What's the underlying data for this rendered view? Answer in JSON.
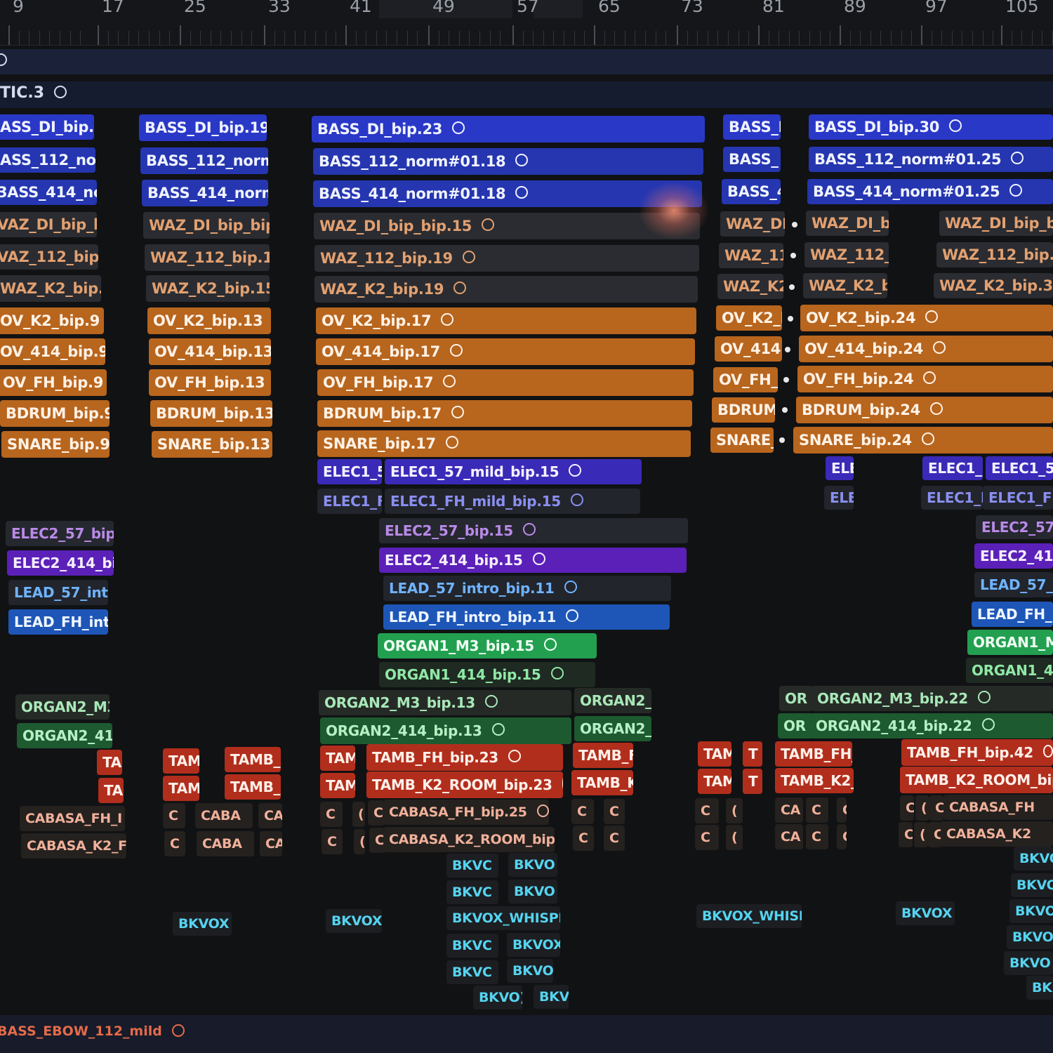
{
  "ruler": {
    "bars": [
      "9",
      "17",
      "25",
      "33",
      "41",
      "49",
      "57",
      "65",
      "73",
      "81",
      "89",
      "97",
      "105"
    ]
  },
  "lanes": {
    "top_label": "",
    "tic_label": "TIC.3",
    "bottom_label": "BASS_EBOW_112_mild"
  },
  "clips": [
    {
      "text": "ASS_DI_bip.1",
      "tone": "blue",
      "circle": false
    },
    {
      "text": "BASS_DI_bip.19",
      "tone": "blue",
      "circle": false
    },
    {
      "text": "BASS_DI_bip.23",
      "tone": "blue",
      "circle": true
    },
    {
      "text": "BASS_I",
      "tone": "blue",
      "circle": false
    },
    {
      "text": "BASS_DI_bip.30",
      "tone": "blue",
      "circle": true
    },
    {
      "text": "ASS_112_nor",
      "tone": "dblue",
      "circle": false
    },
    {
      "text": "BASS_112_norm",
      "tone": "dblue",
      "circle": false
    },
    {
      "text": "BASS_112_norm#01.18",
      "tone": "dblue",
      "circle": true
    },
    {
      "text": "BASS_",
      "tone": "dblue",
      "circle": false
    },
    {
      "text": "BASS_112_norm#01.25",
      "tone": "dblue",
      "circle": true
    },
    {
      "text": "3ASS_414_nor",
      "tone": "dblue",
      "circle": false
    },
    {
      "text": "BASS_414_norm",
      "tone": "dblue",
      "circle": false
    },
    {
      "text": "BASS_414_norm#01.18",
      "tone": "dblue",
      "circle": true
    },
    {
      "text": "BASS_4",
      "tone": "dblue",
      "circle": false
    },
    {
      "text": "BASS_414_norm#01.25",
      "tone": "dblue",
      "circle": true
    },
    {
      "text": "VAZ_DI_bip_b",
      "tone": "gray",
      "circle": false
    },
    {
      "text": "WAZ_DI_bip_bip.",
      "tone": "gray",
      "circle": false
    },
    {
      "text": "WAZ_DI_bip_bip.15",
      "tone": "gray",
      "circle": true
    },
    {
      "text": "WAZ_DI",
      "tone": "gray",
      "circle": false
    },
    {
      "text": "WAZ_DI_bi",
      "tone": "gray",
      "circle": false
    },
    {
      "text": "WAZ_DI_bip_bip",
      "tone": "gray",
      "circle": false
    },
    {
      "text": "VAZ_112_bip.",
      "tone": "gray",
      "circle": false
    },
    {
      "text": "WAZ_112_bip.15",
      "tone": "gray",
      "circle": false
    },
    {
      "text": "WAZ_112_bip.19",
      "tone": "gray",
      "circle": true
    },
    {
      "text": "WAZ_11:",
      "tone": "gray",
      "circle": false
    },
    {
      "text": "WAZ_112_I",
      "tone": "gray",
      "circle": false
    },
    {
      "text": "WAZ_112_bip.31",
      "tone": "gray",
      "circle": false
    },
    {
      "text": "WAZ_K2_bip.1",
      "tone": "gray",
      "circle": false
    },
    {
      "text": "WAZ_K2_bip.15",
      "tone": "gray",
      "circle": false
    },
    {
      "text": "WAZ_K2_bip.19",
      "tone": "gray",
      "circle": true
    },
    {
      "text": "WAZ_K2",
      "tone": "gray",
      "circle": false
    },
    {
      "text": "WAZ_K2_b",
      "tone": "gray",
      "circle": false
    },
    {
      "text": "WAZ_K2_bip.31",
      "tone": "gray",
      "circle": false
    },
    {
      "text": "OV_K2_bip.9",
      "tone": "orange",
      "circle": false
    },
    {
      "text": "OV_K2_bip.13",
      "tone": "orange",
      "circle": false
    },
    {
      "text": "OV_K2_bip.17",
      "tone": "orange",
      "circle": true
    },
    {
      "text": "OV_K2_I",
      "tone": "orange",
      "circle": false
    },
    {
      "text": "OV_K2_bip.24",
      "tone": "orange",
      "circle": true
    },
    {
      "text": "OV_414_bip.9",
      "tone": "orange",
      "circle": false
    },
    {
      "text": "OV_414_bip.13",
      "tone": "orange",
      "circle": false
    },
    {
      "text": "OV_414_bip.17",
      "tone": "orange",
      "circle": true
    },
    {
      "text": "OV_414",
      "tone": "orange",
      "circle": false
    },
    {
      "text": "OV_414_bip.24",
      "tone": "orange",
      "circle": true
    },
    {
      "text": "OV_FH_bip.9",
      "tone": "orange",
      "circle": false
    },
    {
      "text": "OV_FH_bip.13",
      "tone": "orange",
      "circle": false
    },
    {
      "text": "OV_FH_bip.17",
      "tone": "orange",
      "circle": true
    },
    {
      "text": "OV_FH_I",
      "tone": "orange",
      "circle": false
    },
    {
      "text": "OV_FH_bip.24",
      "tone": "orange",
      "circle": true
    },
    {
      "text": "BDRUM_bip.9",
      "tone": "orange",
      "circle": false
    },
    {
      "text": "BDRUM_bip.13",
      "tone": "orange",
      "circle": false
    },
    {
      "text": "BDRUM_bip.17",
      "tone": "orange",
      "circle": true
    },
    {
      "text": "BDRUM",
      "tone": "orange",
      "circle": false
    },
    {
      "text": "BDRUM_bip.24",
      "tone": "orange",
      "circle": true
    },
    {
      "text": "SNARE_bip.9",
      "tone": "orange",
      "circle": false
    },
    {
      "text": "SNARE_bip.13",
      "tone": "orange",
      "circle": false
    },
    {
      "text": "SNARE_bip.17",
      "tone": "orange",
      "circle": true
    },
    {
      "text": "SNARE_",
      "tone": "orange",
      "circle": false
    },
    {
      "text": "SNARE_bip.24",
      "tone": "orange",
      "circle": true
    },
    {
      "text": "ELEC1_5",
      "tone": "indigo",
      "circle": false
    },
    {
      "text": "ELEC1_57_mild_bip.15",
      "tone": "indigo",
      "circle": true
    },
    {
      "text": "ELE",
      "tone": "indigo",
      "circle": false
    },
    {
      "text": "ELEC1_!",
      "tone": "indigo",
      "circle": false
    },
    {
      "text": "ELEC1_57",
      "tone": "indigo",
      "circle": false
    },
    {
      "text": "ELEC1_F",
      "tone": "slate",
      "circle": false
    },
    {
      "text": "ELEC1_FH_mild_bip.15",
      "tone": "slate",
      "circle": true
    },
    {
      "text": "ELE",
      "tone": "slate",
      "circle": false
    },
    {
      "text": "ELEC1_I",
      "tone": "slate",
      "circle": false
    },
    {
      "text": "ELEC1_FH",
      "tone": "slate",
      "circle": false
    },
    {
      "text": "ELEC2_57_bip",
      "tone": "violet",
      "circle": false
    },
    {
      "text": "ELEC2_57_bip.15",
      "tone": "violet",
      "circle": true
    },
    {
      "text": "ELEC2_57",
      "tone": "violet",
      "circle": false
    },
    {
      "text": "ELEC2_414_bi",
      "tone": "purple",
      "circle": false
    },
    {
      "text": "ELEC2_414_bip.15",
      "tone": "purple",
      "circle": true
    },
    {
      "text": "ELEC2_414",
      "tone": "purple",
      "circle": false
    },
    {
      "text": "LEAD_57_intr",
      "tone": "lead",
      "circle": false
    },
    {
      "text": "LEAD_57_intro_bip.11",
      "tone": "lead",
      "circle": true
    },
    {
      "text": "LEAD_57_i",
      "tone": "lead",
      "circle": false
    },
    {
      "text": "LEAD_FH_int",
      "tone": "leadb",
      "circle": false
    },
    {
      "text": "LEAD_FH_intro_bip.11",
      "tone": "leadb",
      "circle": true
    },
    {
      "text": "LEAD_FH_i",
      "tone": "leadb",
      "circle": false
    },
    {
      "text": "ORGAN1_M3_bip.15",
      "tone": "green",
      "circle": true
    },
    {
      "text": "ORGAN1_M3",
      "tone": "green",
      "circle": false
    },
    {
      "text": "ORGAN1_414_bip.15",
      "tone": "dgreen",
      "circle": true
    },
    {
      "text": "ORGAN1_414",
      "tone": "dgreen",
      "circle": false
    },
    {
      "text": "ORGAN2_M3",
      "tone": "org2d",
      "circle": false
    },
    {
      "text": "ORGAN2_M3_bip.13",
      "tone": "org2d",
      "circle": true
    },
    {
      "text": "ORGAN2_I",
      "tone": "org2d",
      "circle": false
    },
    {
      "text": "OR",
      "tone": "org2d",
      "circle": false
    },
    {
      "text": "ORGAN2_M3_bip.22",
      "tone": "org2d",
      "circle": true
    },
    {
      "text": "ORGAN2_414",
      "tone": "org2",
      "circle": false
    },
    {
      "text": "ORGAN2_414_bip.13",
      "tone": "org2",
      "circle": true
    },
    {
      "text": "ORGAN2_4",
      "tone": "org2",
      "circle": false
    },
    {
      "text": "OR",
      "tone": "org2",
      "circle": false
    },
    {
      "text": "ORGAN2_414_bip.22",
      "tone": "org2",
      "circle": true
    },
    {
      "text": "TA",
      "tone": "red",
      "circle": false
    },
    {
      "text": "TAM",
      "tone": "red",
      "circle": false
    },
    {
      "text": "TAMB_",
      "tone": "red",
      "circle": false
    },
    {
      "text": "TAM",
      "tone": "red",
      "circle": false
    },
    {
      "text": "TAMB_FH_bip.23",
      "tone": "red",
      "circle": true
    },
    {
      "text": "TAMB_F",
      "tone": "red",
      "circle": false
    },
    {
      "text": "TAM",
      "tone": "red",
      "circle": false
    },
    {
      "text": "T",
      "tone": "red",
      "circle": false
    },
    {
      "text": "TAMB_FH_",
      "tone": "red",
      "circle": false
    },
    {
      "text": "TAMB_FH_bip.42",
      "tone": "red",
      "circle": true
    },
    {
      "text": "TA",
      "tone": "red",
      "circle": false
    },
    {
      "text": "TAM",
      "tone": "red",
      "circle": false
    },
    {
      "text": "TAMB_",
      "tone": "red",
      "circle": false
    },
    {
      "text": "TAM",
      "tone": "red",
      "circle": false
    },
    {
      "text": "TAMB_K2_ROOM_bip.23",
      "tone": "red",
      "circle": true
    },
    {
      "text": "TAMB_K",
      "tone": "red",
      "circle": false
    },
    {
      "text": "TAM",
      "tone": "red",
      "circle": false
    },
    {
      "text": "T",
      "tone": "red",
      "circle": false
    },
    {
      "text": "TAMB_K2_",
      "tone": "red",
      "circle": false
    },
    {
      "text": "TAMB_K2_ROOM_bip.4",
      "tone": "red",
      "circle": false
    },
    {
      "text": "CABASA_FH_I",
      "tone": "cab",
      "circle": false
    },
    {
      "text": "C",
      "tone": "cab",
      "circle": false
    },
    {
      "text": "CABA",
      "tone": "cab",
      "circle": false
    },
    {
      "text": "CA",
      "tone": "cab",
      "circle": false
    },
    {
      "text": "C",
      "tone": "cab",
      "circle": false
    },
    {
      "text": "(",
      "tone": "cab",
      "circle": false
    },
    {
      "text": "C",
      "tone": "cab",
      "circle": false
    },
    {
      "text": "CABASA_FH_bip.25",
      "tone": "cab",
      "circle": true
    },
    {
      "text": "C",
      "tone": "cab",
      "circle": false
    },
    {
      "text": "C",
      "tone": "cab",
      "circle": false
    },
    {
      "text": "C",
      "tone": "cab",
      "circle": false
    },
    {
      "text": "(",
      "tone": "cab",
      "circle": false
    },
    {
      "text": "CA",
      "tone": "cab",
      "circle": false
    },
    {
      "text": "C",
      "tone": "cab",
      "circle": false
    },
    {
      "text": "C",
      "tone": "cab",
      "circle": false
    },
    {
      "text": "C",
      "tone": "cab",
      "circle": false
    },
    {
      "text": "(",
      "tone": "cab",
      "circle": false
    },
    {
      "text": "C",
      "tone": "cab",
      "circle": false
    },
    {
      "text": "CABASA_FH",
      "tone": "cab",
      "circle": false
    },
    {
      "text": "CABASA_K2_F",
      "tone": "cab",
      "circle": false
    },
    {
      "text": "C",
      "tone": "cab",
      "circle": false
    },
    {
      "text": "CABA",
      "tone": "cab",
      "circle": false
    },
    {
      "text": "CA",
      "tone": "cab",
      "circle": false
    },
    {
      "text": "C",
      "tone": "cab",
      "circle": false
    },
    {
      "text": "(",
      "tone": "cab",
      "circle": false
    },
    {
      "text": "C",
      "tone": "cab",
      "circle": false
    },
    {
      "text": "CABASA_K2_ROOM_bip.",
      "tone": "cab",
      "circle": false
    },
    {
      "text": "C",
      "tone": "cab",
      "circle": false
    },
    {
      "text": "C",
      "tone": "cab",
      "circle": false
    },
    {
      "text": "C",
      "tone": "cab",
      "circle": false
    },
    {
      "text": "(",
      "tone": "cab",
      "circle": false
    },
    {
      "text": "CA",
      "tone": "cab",
      "circle": false
    },
    {
      "text": "C",
      "tone": "cab",
      "circle": false
    },
    {
      "text": "C",
      "tone": "cab",
      "circle": false
    },
    {
      "text": "C",
      "tone": "cab",
      "circle": false
    },
    {
      "text": "(",
      "tone": "cab",
      "circle": false
    },
    {
      "text": "C",
      "tone": "cab",
      "circle": false
    },
    {
      "text": "CABASA_K2",
      "tone": "cab",
      "circle": false
    },
    {
      "text": "BKVC",
      "tone": "bkv",
      "circle": false
    },
    {
      "text": "BKVO",
      "tone": "bkv",
      "circle": false
    },
    {
      "text": "BKVO",
      "tone": "bkv",
      "circle": false
    },
    {
      "text": "BKVC",
      "tone": "bkv",
      "circle": false
    },
    {
      "text": "BKVO",
      "tone": "bkv",
      "circle": false
    },
    {
      "text": "BKVO",
      "tone": "bkv",
      "circle": false
    },
    {
      "text": "BKVOX",
      "tone": "bkv",
      "circle": false
    },
    {
      "text": "BKVOX",
      "tone": "bkv",
      "circle": false
    },
    {
      "text": "BKVOX_WHISPE",
      "tone": "bkv",
      "circle": false
    },
    {
      "text": "BKVOX_WHISP",
      "tone": "bkv",
      "circle": false
    },
    {
      "text": "BKVOX",
      "tone": "bkv",
      "circle": false
    },
    {
      "text": "BKVO",
      "tone": "bkv",
      "circle": false
    },
    {
      "text": "BKVC",
      "tone": "bkv",
      "circle": false
    },
    {
      "text": "BKVOX",
      "tone": "bkv",
      "circle": false
    },
    {
      "text": "BKVO",
      "tone": "bkv",
      "circle": false
    },
    {
      "text": "BKVC",
      "tone": "bkv",
      "circle": false
    },
    {
      "text": "BKVO",
      "tone": "bkv",
      "circle": false
    },
    {
      "text": "BKVO",
      "tone": "bkv",
      "circle": false
    },
    {
      "text": "BKVO)",
      "tone": "bkv",
      "circle": false
    },
    {
      "text": "BKV",
      "tone": "bkv",
      "circle": false
    },
    {
      "text": "BK",
      "tone": "bkv",
      "circle": false
    }
  ]
}
